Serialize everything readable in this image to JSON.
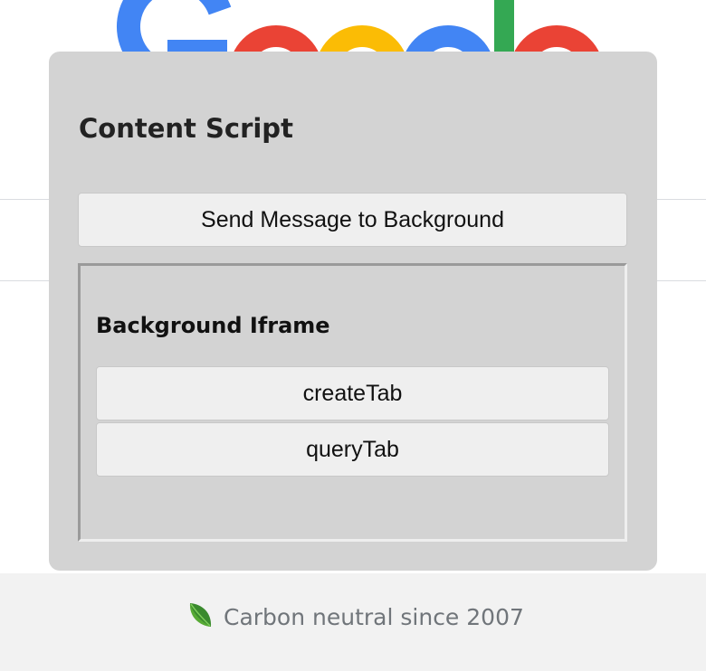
{
  "footer": {
    "carbon_text": "Carbon neutral since 2007"
  },
  "content_script": {
    "title": "Content Script",
    "send_button_label": "Send Message to Background"
  },
  "background_iframe": {
    "title": "Background Iframe",
    "buttons": [
      {
        "label": "createTab"
      },
      {
        "label": "queryTab"
      }
    ]
  },
  "colors": {
    "google_blue": "#4285F4",
    "google_red": "#EA4335",
    "google_yellow": "#FBBC05",
    "google_green": "#34A853",
    "panel_bg": "#d3d3d3",
    "leaf_green": "#3a8a2e"
  },
  "icons": {
    "google_logo": "google-logo",
    "leaf": "leaf-icon"
  }
}
